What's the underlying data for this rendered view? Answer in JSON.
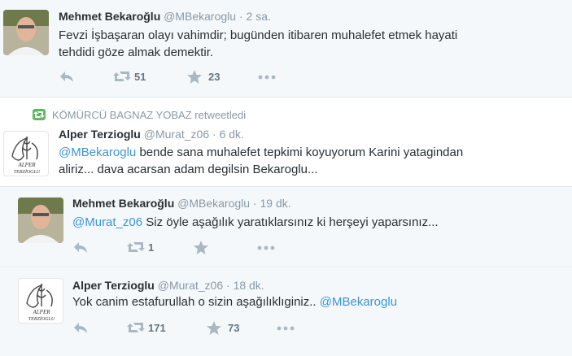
{
  "tweets": [
    {
      "name": "Mehmet Bekaroğlu",
      "handle": "@MBekaroglu",
      "time": "2 sa.",
      "line1": "Fevzi İşbaşaran olayı vahimdir; bugünden itibaren muhalefet etmek hayati",
      "line2": "tehdidi göze almak demektir.",
      "retweets": "51",
      "favorites": "23"
    },
    {
      "retweeted_by": "KÖMÜRCÜ BAGNAZ YOBAZ retweetledi",
      "name": "Alper Terzioglu",
      "handle": "@Murat_z06",
      "time": "6 dk.",
      "mention": "@MBekaroglu",
      "line1": " bende sana muhalefet tepkimi koyuyorum Karini yatagindan",
      "line2": "aliriz... dava acarsan adam degilsin Bekaroglu...",
      "avatar_text": [
        "ALPER",
        "TERZİOGLU"
      ]
    },
    {
      "name": "Mehmet Bekaroğlu",
      "handle": "@MBekaroglu",
      "time": "19 dk.",
      "mention": "@Murat_z06",
      "line1": " Siz öyle aşağılık yaratıklarsınız ki herşeyi yaparsınız...",
      "retweets": "1"
    },
    {
      "name": "Alper Terzioglu",
      "handle": "@Murat_z06",
      "time": "18 dk.",
      "line1": "Yok canim estafurullah o sizin aşağılıklıginiz.. ",
      "mention": "@MBekaroglu",
      "retweets": "171",
      "favorites": "73",
      "avatar_text": [
        "ALPER",
        "TERZİOGLU"
      ]
    }
  ],
  "sep": "·",
  "icons": [
    "reply-icon",
    "retweet-icon",
    "favorite-star-icon",
    "more-dots-icon"
  ],
  "colors": {
    "link": "#3b94d9",
    "muted": "#8899a6",
    "retweet_badge": "#5fb85f"
  }
}
